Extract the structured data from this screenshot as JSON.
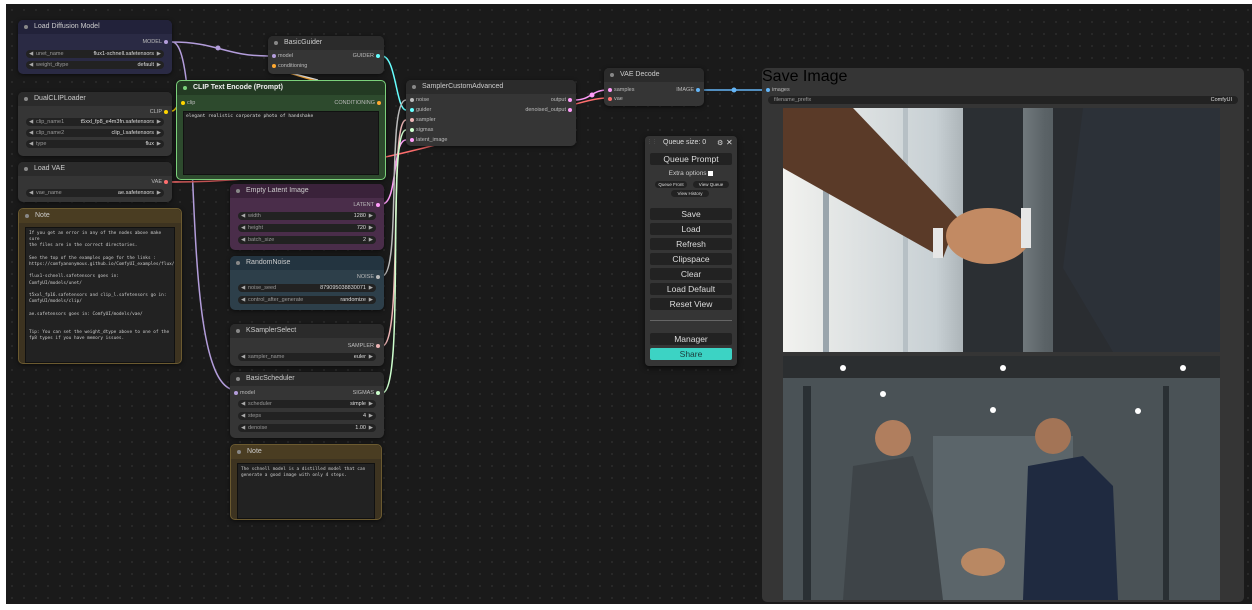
{
  "nodes": {
    "load_diffusion_model": {
      "title": "Load Diffusion Model",
      "output_model": "MODEL",
      "widgets": [
        {
          "label": "unet_name",
          "value": "flux1-schnell.safetensors"
        },
        {
          "label": "weight_dtype",
          "value": "default"
        }
      ]
    },
    "dual_clip_loader": {
      "title": "DualCLIPLoader",
      "output_clip": "CLIP",
      "widgets": [
        {
          "label": "clip_name1",
          "value": "t5xxl_fp8_e4m3fn.safetensors"
        },
        {
          "label": "clip_name2",
          "value": "clip_l.safetensors"
        },
        {
          "label": "type",
          "value": "flux"
        }
      ]
    },
    "load_vae": {
      "title": "Load VAE",
      "output_vae": "VAE",
      "widgets": [
        {
          "label": "vae_name",
          "value": "ae.safetensors"
        }
      ]
    },
    "note_left": {
      "title": "Note",
      "text": "If you get an error in any of the nodes above make sure\nthe files are in the correct directories.\n\nSee the top of the examples page for the links :\nhttps://comfyanonymous.github.io/ComfyUI_examples/flux/\n\nflux1-schnell.safetensors goes in: ComfyUI/models/unet/\n\nt5xxl_fp16.safetensors and clip_l.safetensors go in:\nComfyUI/models/clip/\n\nae.safetensors goes in: ComfyUI/models/vae/\n\n\nTip: You can set the weight_dtype above to one of the\nfp8 types if you have memory issues."
    },
    "basic_guider": {
      "title": "BasicGuider",
      "input_model": "model",
      "input_conditioning": "conditioning",
      "output_guider": "GUIDER"
    },
    "clip_text_encode": {
      "title": "CLIP Text Encode (Prompt)",
      "input_clip": "clip",
      "output_conditioning": "CONDITIONING",
      "prompt": "elegant realistic corporate photo of handshake"
    },
    "sampler_custom_advanced": {
      "title": "SamplerCustomAdvanced",
      "inputs": [
        "noise",
        "guider",
        "sampler",
        "sigmas",
        "latent_image"
      ],
      "output_output": "output",
      "output_denoised": "denoised_output"
    },
    "vae_decode": {
      "title": "VAE Decode",
      "input_samples": "samples",
      "input_vae": "vae",
      "output_image": "IMAGE"
    },
    "save_image": {
      "title": "Save Image",
      "input_images": "images",
      "widget_label": "filename_prefix",
      "widget_value": "ComfyUI"
    },
    "empty_latent_image": {
      "title": "Empty Latent Image",
      "output_latent": "LATENT",
      "widgets": [
        {
          "label": "width",
          "value": "1280"
        },
        {
          "label": "height",
          "value": "720"
        },
        {
          "label": "batch_size",
          "value": "2"
        }
      ]
    },
    "random_noise": {
      "title": "RandomNoise",
      "output_noise": "NOISE",
      "widgets": [
        {
          "label": "noise_seed",
          "value": "879095038830071"
        },
        {
          "label": "control_after_generate",
          "value": "randomize"
        }
      ]
    },
    "ksampler_select": {
      "title": "KSamplerSelect",
      "output_sampler": "SAMPLER",
      "widgets": [
        {
          "label": "sampler_name",
          "value": "euler"
        }
      ]
    },
    "basic_scheduler": {
      "title": "BasicScheduler",
      "input_model": "model",
      "output_sigmas": "SIGMAS",
      "widgets": [
        {
          "label": "scheduler",
          "value": "simple"
        },
        {
          "label": "steps",
          "value": "4"
        },
        {
          "label": "denoise",
          "value": "1.00"
        }
      ]
    },
    "note_bottom": {
      "title": "Note",
      "text": "The schnell model is a distilled model that can\ngenerate a good image with only 4 steps."
    }
  },
  "queue_panel": {
    "queue_size_label": "Queue size: 0",
    "queue_prompt": "Queue Prompt",
    "extra_options": "Extra options",
    "queue_front": "Queue Front",
    "view_queue": "View Queue",
    "view_history": "View History",
    "buttons": [
      "Save",
      "Load",
      "Refresh",
      "Clipspace",
      "Clear",
      "Load Default",
      "Reset View"
    ],
    "manager": "Manager",
    "share": "Share"
  },
  "colors": {
    "canvas": "#1a1a1a",
    "node_body": "#353535",
    "clip_node": "#2d4a2d",
    "latent_node": "#4a2d4a",
    "noise_node": "#2d3f4a",
    "note_node": "#3d3320",
    "loader_node": "#2a2a44",
    "model_link": "#b39ddb",
    "clip_link": "#ffd500",
    "vae_link": "#ff6e6e",
    "conditioning_link": "#ffa931",
    "latent_link": "#ff9cf9",
    "image_link": "#64b5f6",
    "guider_link": "#66ffff",
    "sampler_link": "#ecb4b4",
    "sigmas_link": "#cdffcd",
    "share_button": "#3cd3c4"
  },
  "icons": [
    "gear-icon",
    "close-icon",
    "checkbox-icon"
  ]
}
